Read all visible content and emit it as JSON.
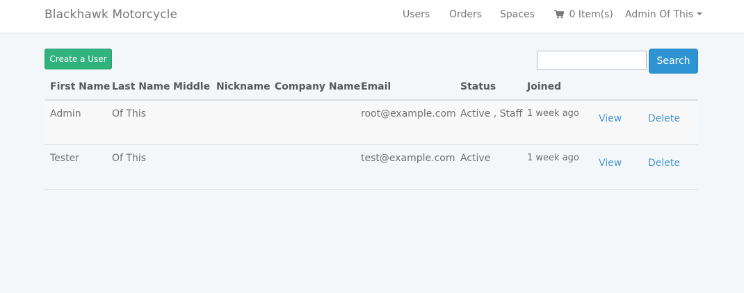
{
  "navbar": {
    "brand": "Blackhawk Motorcycle",
    "users": "Users",
    "orders": "Orders",
    "spaces": "Spaces",
    "cart": "0 Item(s)",
    "cart_icon": "shopping-cart-icon",
    "account": "Admin Of This"
  },
  "toolbar": {
    "create_label": "Create a User",
    "search_value": "",
    "search_label": "Search"
  },
  "table": {
    "headers": {
      "first": "First Name",
      "last": "Last Name",
      "middle": "Middle",
      "nickname": "Nickname",
      "company": "Company Name",
      "email": "Email",
      "status": "Status",
      "joined": "Joined"
    },
    "rows": [
      {
        "first": "Admin",
        "last": "Of This",
        "middle": "",
        "nickname": "",
        "company": "",
        "email": "root@example.com",
        "status": "Active , Staff",
        "joined": "1 week ago",
        "view": "View",
        "delete": "Delete"
      },
      {
        "first": "Tester",
        "last": "Of This",
        "middle": "",
        "nickname": "",
        "company": "",
        "email": "test@example.com",
        "status": "Active",
        "joined": "1 week ago",
        "view": "View",
        "delete": "Delete"
      }
    ]
  },
  "colors": {
    "create_button": "#2fb27b",
    "search_button": "#2e93d3",
    "link": "#4a95cf",
    "page_background": "#f3f7fa"
  }
}
